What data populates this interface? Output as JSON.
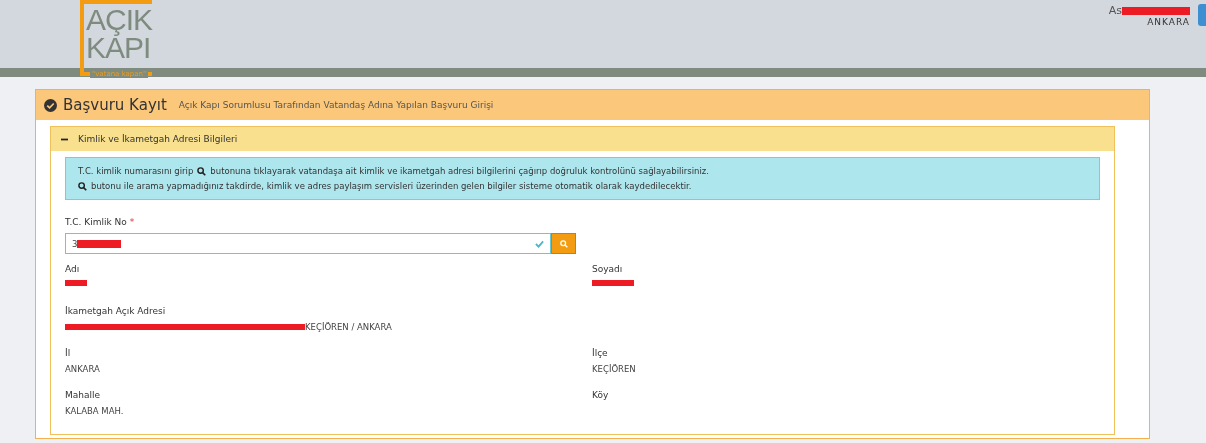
{
  "header": {
    "logo": {
      "line1": "AÇIK",
      "line2": "KAPI",
      "tagline": "\"vatana kapan\""
    },
    "user": {
      "name": "As",
      "name_redacted": true,
      "city": "ANKARA"
    }
  },
  "panel": {
    "title": "Başvuru Kayıt",
    "subtitle": "Açık Kapı Sorumlusu Tarafından Vatandaş Adına Yapılan Başvuru Girişi",
    "section": {
      "title": "Kimlik ve İkametgah Adresi Bilgileri",
      "expanded": true,
      "info": [
        {
          "before": "T.C. kimlik numarasını girip",
          "after": "butonuna tıklayarak vatandaşa ait kimlik ve ikametgah adresi bilgilerini çağırıp doğruluk kontrolünü sağlayabilirsiniz."
        },
        {
          "after": "butonu ile arama yapmadığınız takdirde, kimlik ve adres paylaşım servisleri üzerinden gelen bilgiler sisteme otomatik olarak kaydedilecektir."
        }
      ],
      "tc_field": {
        "label": "T.C. Kimlik No",
        "required_mark": "*",
        "value": "3",
        "redacted": true,
        "valid": true
      },
      "rows": [
        [
          {
            "label": "Adı",
            "redacted": true
          },
          {
            "label": "Soyadı",
            "redacted": true
          }
        ],
        [
          {
            "label": "İkametgah Açık Adresi",
            "value": "KEÇİÖREN / ANKARA",
            "redacted": true
          }
        ],
        [
          {
            "label": "İl",
            "value": "ANKARA"
          },
          {
            "label": "İlçe",
            "value": "KEÇİÖREN"
          }
        ],
        [
          {
            "label": "Mahalle",
            "value": "KALABA MAH."
          },
          {
            "label": "Köy"
          }
        ]
      ]
    }
  }
}
